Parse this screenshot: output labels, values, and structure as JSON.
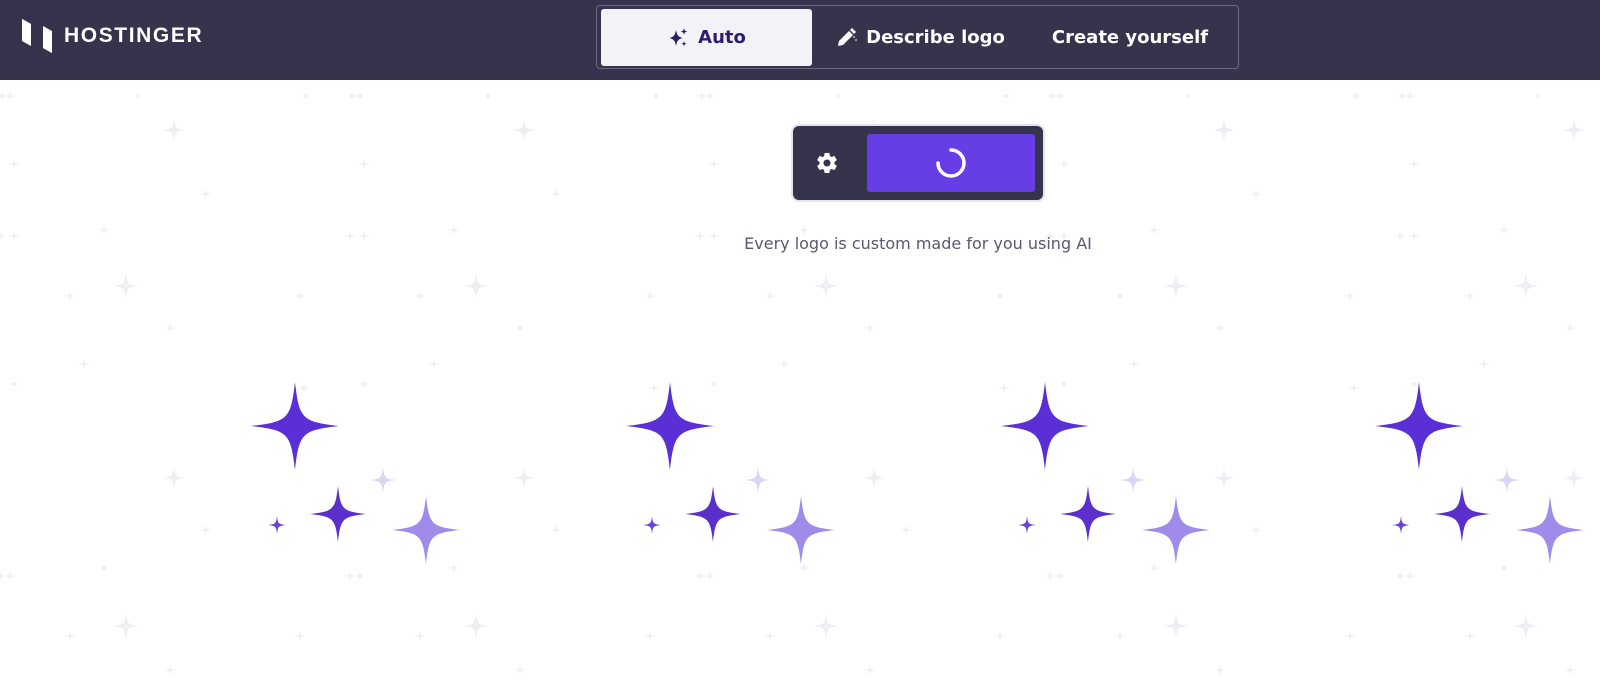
{
  "header": {
    "brand": "HOSTINGER",
    "tabs": [
      {
        "label": "Auto",
        "icon": "sparkles-icon",
        "active": true
      },
      {
        "label": "Describe logo",
        "icon": "pencil-icon",
        "active": false
      },
      {
        "label": "Create yourself",
        "icon": "",
        "active": false
      }
    ]
  },
  "generator": {
    "settings_icon": "gear-icon",
    "generate_state": "loading",
    "tagline": "Every logo is custom made for you using AI"
  },
  "colors": {
    "header_bg": "#36344d",
    "accent": "#673de6",
    "sparkle_dark": "#5a2fd6",
    "sparkle_light": "#a08bea",
    "pattern": "#eeeef3"
  }
}
